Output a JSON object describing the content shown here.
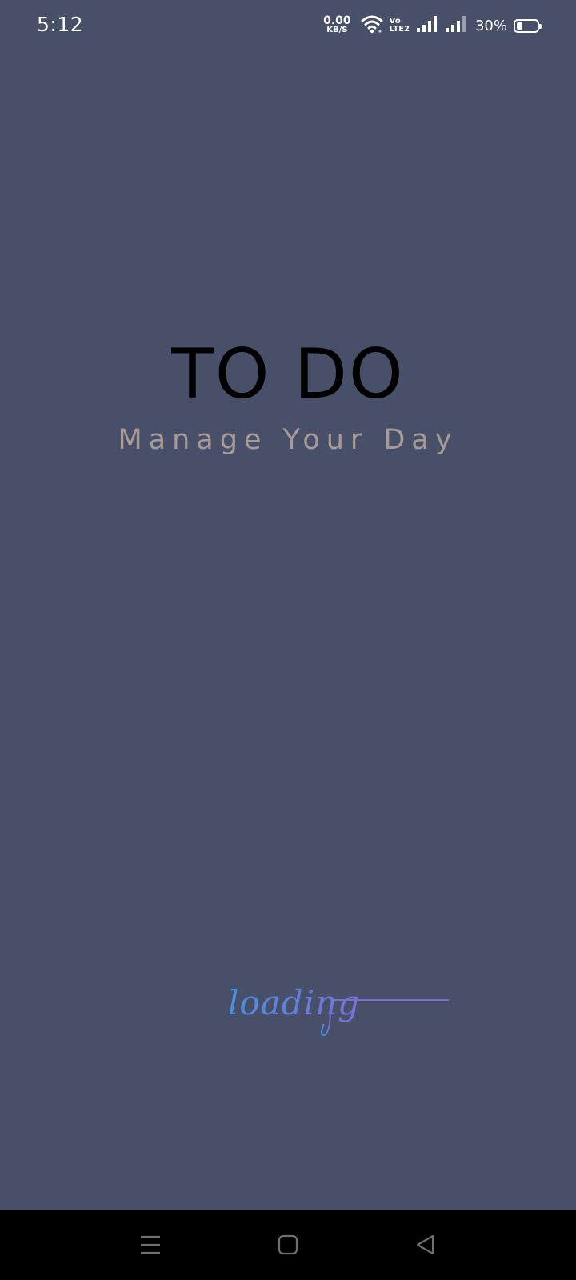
{
  "status_bar": {
    "time": "5:12",
    "net_speed_value": "0.00",
    "net_speed_unit": "KB/S",
    "volte_top": "Vo",
    "volte_bottom": "LTE2",
    "battery_percent": "30%",
    "battery_level": 0.3,
    "icons": [
      "wifi-icon",
      "signal-icon",
      "signal-icon",
      "battery-icon"
    ]
  },
  "splash": {
    "title": "TO DO",
    "subtitle": "Manage Your Day",
    "loading_text": "loading",
    "loading_colors": [
      "#4a90e2",
      "#7b6fd6"
    ]
  },
  "nav_bar": {
    "buttons": [
      "menu-icon",
      "home-icon",
      "back-icon"
    ]
  }
}
